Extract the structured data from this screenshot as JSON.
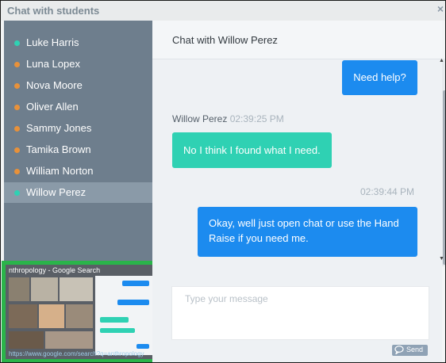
{
  "window": {
    "title": "Chat with students",
    "close_label": "×"
  },
  "sidebar": {
    "students": [
      {
        "name": "Luke Harris",
        "status_color": "#2fd1b3",
        "active": false
      },
      {
        "name": "Luna Lopex",
        "status_color": "#e8913a",
        "active": false
      },
      {
        "name": "Nova Moore",
        "status_color": "#e8913a",
        "active": false
      },
      {
        "name": "Oliver Allen",
        "status_color": "#e8913a",
        "active": false
      },
      {
        "name": "Sammy Jones",
        "status_color": "#e8913a",
        "active": false
      },
      {
        "name": "Tamika Brown",
        "status_color": "#e8913a",
        "active": false
      },
      {
        "name": "William Norton",
        "status_color": "#e8913a",
        "active": false
      },
      {
        "name": "Willow Perez",
        "status_color": "#2fd1b3",
        "active": true
      }
    ],
    "thumbnail": {
      "title": "nthropology - Google Search",
      "url": "https://www.google.com/search?q=anthropology"
    }
  },
  "chat": {
    "title": "Chat with Willow Perez",
    "messages": [
      {
        "direction": "out",
        "text": "Need help?"
      },
      {
        "direction": "in",
        "sender": "Willow Perez",
        "time": "02:39:25 PM",
        "text": "No I think I found what I need."
      },
      {
        "direction": "out",
        "time": "02:39:44 PM",
        "text_line1": "Okay, well just open chat or use the Hand",
        "text_line2": "Raise if you need me."
      }
    ]
  },
  "composer": {
    "placeholder": "Type your message",
    "send_label": "Send"
  },
  "colors": {
    "outgoing_bubble": "#1c8bef",
    "incoming_bubble": "#2fd1b3",
    "sidebar_bg": "#6e7e8d",
    "thumbnail_border": "#2ab44a"
  }
}
